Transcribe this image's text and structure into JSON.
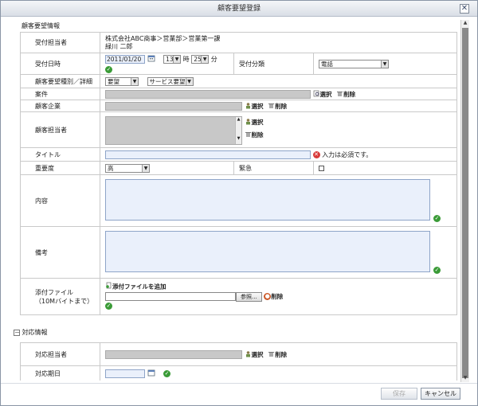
{
  "window": {
    "title": "顧客要望登録",
    "close_glyph": "✕"
  },
  "section1": {
    "title": "顧客要望情報"
  },
  "fields": {
    "receiver": {
      "label": "受付担当者",
      "line1": "株式会社ABC商事＞営業部＞営業第一課",
      "line2": "緑川 二郎"
    },
    "received_at": {
      "label": "受付日時",
      "date": "2011/01/20",
      "hour": "13",
      "hour_unit": "時",
      "minute": "25",
      "minute_unit": "分"
    },
    "category": {
      "label": "受付分類",
      "value": "電話"
    },
    "request_type": {
      "label": "顧客要望種別／詳細",
      "type": "要望",
      "detail": "サービス要望"
    },
    "case": {
      "label": "案件"
    },
    "customer_company": {
      "label": "顧客企業"
    },
    "customer_contact": {
      "label": "顧客担当者"
    },
    "title": {
      "label": "タイトル",
      "error": "入力は必須です。"
    },
    "importance": {
      "label": "重要度",
      "value": "高"
    },
    "urgent": {
      "label": "緊急"
    },
    "content": {
      "label": "内容"
    },
    "remarks": {
      "label": "備考"
    },
    "attachment": {
      "label_line1": "添付ファイル",
      "label_line2": "（10Mバイトまで）",
      "add_link": "添付ファイルを追加",
      "browse": "参照..."
    }
  },
  "section2": {
    "title": "対応情報",
    "toggle": "－"
  },
  "response": {
    "assignee": {
      "label": "対応担当者"
    },
    "due_date": {
      "label": "対応期日"
    }
  },
  "actions": {
    "select": "選択",
    "delete": "削除"
  },
  "buttons": {
    "save": "保存",
    "cancel": "キャンセル"
  },
  "colors": {
    "field_blue": "#eaf0fb",
    "field_gray": "#c8c8c8",
    "ok_green": "#3a9b37",
    "error_red": "#d83a3a"
  }
}
